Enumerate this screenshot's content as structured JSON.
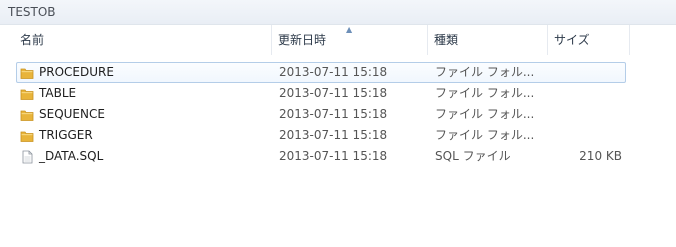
{
  "window": {
    "title": "TESTOB"
  },
  "columns": {
    "name": "名前",
    "date": "更新日時",
    "type": "種類",
    "size": "サイズ"
  },
  "rows": [
    {
      "name": "PROCEDURE",
      "date": "2013-07-11 15:18",
      "type": "ファイル フォル...",
      "size": "",
      "icon": "folder-icon",
      "selected": true
    },
    {
      "name": "TABLE",
      "date": "2013-07-11 15:18",
      "type": "ファイル フォル...",
      "size": "",
      "icon": "folder-icon",
      "selected": false
    },
    {
      "name": "SEQUENCE",
      "date": "2013-07-11 15:18",
      "type": "ファイル フォル...",
      "size": "",
      "icon": "folder-icon",
      "selected": false
    },
    {
      "name": "TRIGGER",
      "date": "2013-07-11 15:18",
      "type": "ファイル フォル...",
      "size": "",
      "icon": "folder-icon",
      "selected": false
    },
    {
      "name": "_DATA.SQL",
      "date": "2013-07-11 15:18",
      "type": "SQL ファイル",
      "size": "210 KB",
      "icon": "document-icon",
      "selected": false
    }
  ],
  "colors": {
    "selection_border": "#b4cde8",
    "folder": "#e8b43a"
  }
}
